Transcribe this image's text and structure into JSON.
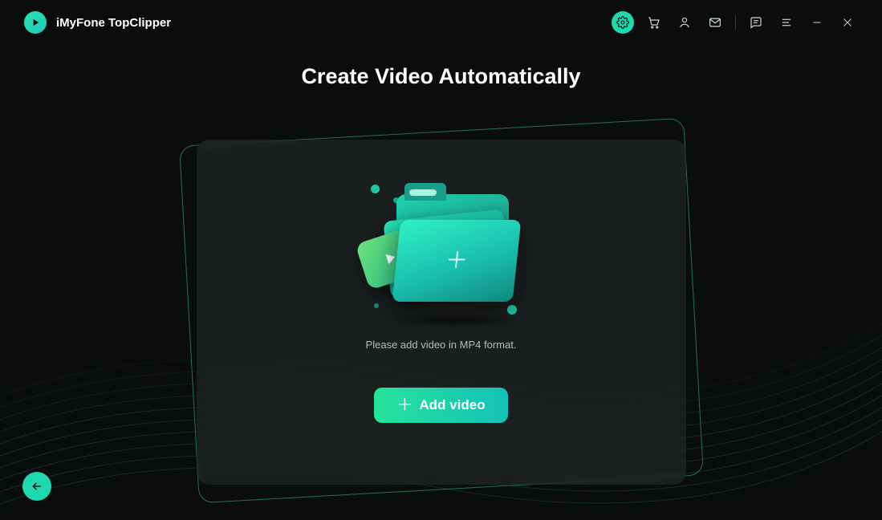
{
  "app": {
    "name": "iMyFone TopClipper"
  },
  "header": {
    "icons": {
      "settings": "gear-icon",
      "cart": "cart-icon",
      "account": "user-icon",
      "mail": "mail-icon",
      "feedback": "message-square-icon",
      "menu": "menu-icon",
      "minimize": "minimize-icon",
      "close": "close-icon"
    }
  },
  "main": {
    "title": "Create Video Automatically",
    "hint": "Please add video in MP4 format.",
    "add_button": "Add video",
    "illustration": "folder-add-video"
  },
  "footer": {
    "back": "back-arrow"
  },
  "colors": {
    "accent": "#1fd8b0",
    "accent_gradient_end": "#16c1b8",
    "bg": "#0b0d0d"
  }
}
